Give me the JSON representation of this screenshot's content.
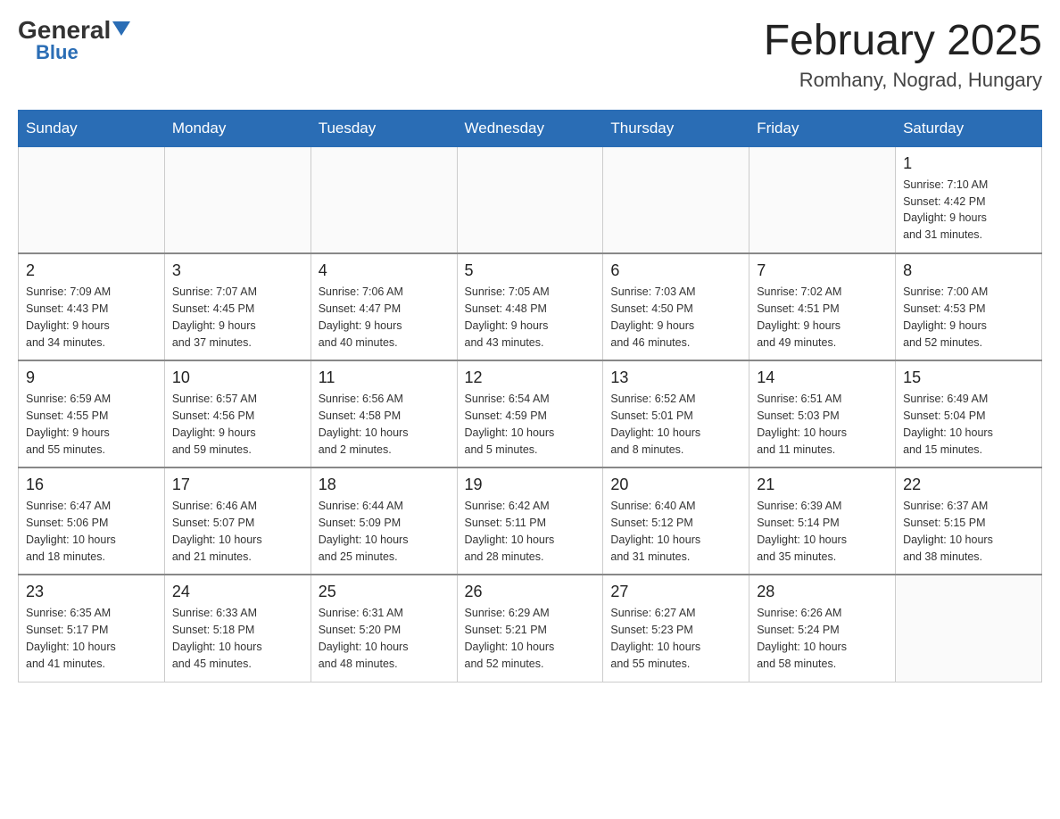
{
  "header": {
    "logo_general": "General",
    "logo_blue": "Blue",
    "month_title": "February 2025",
    "location": "Romhany, Nograd, Hungary"
  },
  "weekdays": [
    "Sunday",
    "Monday",
    "Tuesday",
    "Wednesday",
    "Thursday",
    "Friday",
    "Saturday"
  ],
  "weeks": [
    [
      {
        "day": "",
        "info": ""
      },
      {
        "day": "",
        "info": ""
      },
      {
        "day": "",
        "info": ""
      },
      {
        "day": "",
        "info": ""
      },
      {
        "day": "",
        "info": ""
      },
      {
        "day": "",
        "info": ""
      },
      {
        "day": "1",
        "info": "Sunrise: 7:10 AM\nSunset: 4:42 PM\nDaylight: 9 hours\nand 31 minutes."
      }
    ],
    [
      {
        "day": "2",
        "info": "Sunrise: 7:09 AM\nSunset: 4:43 PM\nDaylight: 9 hours\nand 34 minutes."
      },
      {
        "day": "3",
        "info": "Sunrise: 7:07 AM\nSunset: 4:45 PM\nDaylight: 9 hours\nand 37 minutes."
      },
      {
        "day": "4",
        "info": "Sunrise: 7:06 AM\nSunset: 4:47 PM\nDaylight: 9 hours\nand 40 minutes."
      },
      {
        "day": "5",
        "info": "Sunrise: 7:05 AM\nSunset: 4:48 PM\nDaylight: 9 hours\nand 43 minutes."
      },
      {
        "day": "6",
        "info": "Sunrise: 7:03 AM\nSunset: 4:50 PM\nDaylight: 9 hours\nand 46 minutes."
      },
      {
        "day": "7",
        "info": "Sunrise: 7:02 AM\nSunset: 4:51 PM\nDaylight: 9 hours\nand 49 minutes."
      },
      {
        "day": "8",
        "info": "Sunrise: 7:00 AM\nSunset: 4:53 PM\nDaylight: 9 hours\nand 52 minutes."
      }
    ],
    [
      {
        "day": "9",
        "info": "Sunrise: 6:59 AM\nSunset: 4:55 PM\nDaylight: 9 hours\nand 55 minutes."
      },
      {
        "day": "10",
        "info": "Sunrise: 6:57 AM\nSunset: 4:56 PM\nDaylight: 9 hours\nand 59 minutes."
      },
      {
        "day": "11",
        "info": "Sunrise: 6:56 AM\nSunset: 4:58 PM\nDaylight: 10 hours\nand 2 minutes."
      },
      {
        "day": "12",
        "info": "Sunrise: 6:54 AM\nSunset: 4:59 PM\nDaylight: 10 hours\nand 5 minutes."
      },
      {
        "day": "13",
        "info": "Sunrise: 6:52 AM\nSunset: 5:01 PM\nDaylight: 10 hours\nand 8 minutes."
      },
      {
        "day": "14",
        "info": "Sunrise: 6:51 AM\nSunset: 5:03 PM\nDaylight: 10 hours\nand 11 minutes."
      },
      {
        "day": "15",
        "info": "Sunrise: 6:49 AM\nSunset: 5:04 PM\nDaylight: 10 hours\nand 15 minutes."
      }
    ],
    [
      {
        "day": "16",
        "info": "Sunrise: 6:47 AM\nSunset: 5:06 PM\nDaylight: 10 hours\nand 18 minutes."
      },
      {
        "day": "17",
        "info": "Sunrise: 6:46 AM\nSunset: 5:07 PM\nDaylight: 10 hours\nand 21 minutes."
      },
      {
        "day": "18",
        "info": "Sunrise: 6:44 AM\nSunset: 5:09 PM\nDaylight: 10 hours\nand 25 minutes."
      },
      {
        "day": "19",
        "info": "Sunrise: 6:42 AM\nSunset: 5:11 PM\nDaylight: 10 hours\nand 28 minutes."
      },
      {
        "day": "20",
        "info": "Sunrise: 6:40 AM\nSunset: 5:12 PM\nDaylight: 10 hours\nand 31 minutes."
      },
      {
        "day": "21",
        "info": "Sunrise: 6:39 AM\nSunset: 5:14 PM\nDaylight: 10 hours\nand 35 minutes."
      },
      {
        "day": "22",
        "info": "Sunrise: 6:37 AM\nSunset: 5:15 PM\nDaylight: 10 hours\nand 38 minutes."
      }
    ],
    [
      {
        "day": "23",
        "info": "Sunrise: 6:35 AM\nSunset: 5:17 PM\nDaylight: 10 hours\nand 41 minutes."
      },
      {
        "day": "24",
        "info": "Sunrise: 6:33 AM\nSunset: 5:18 PM\nDaylight: 10 hours\nand 45 minutes."
      },
      {
        "day": "25",
        "info": "Sunrise: 6:31 AM\nSunset: 5:20 PM\nDaylight: 10 hours\nand 48 minutes."
      },
      {
        "day": "26",
        "info": "Sunrise: 6:29 AM\nSunset: 5:21 PM\nDaylight: 10 hours\nand 52 minutes."
      },
      {
        "day": "27",
        "info": "Sunrise: 6:27 AM\nSunset: 5:23 PM\nDaylight: 10 hours\nand 55 minutes."
      },
      {
        "day": "28",
        "info": "Sunrise: 6:26 AM\nSunset: 5:24 PM\nDaylight: 10 hours\nand 58 minutes."
      },
      {
        "day": "",
        "info": ""
      }
    ]
  ]
}
